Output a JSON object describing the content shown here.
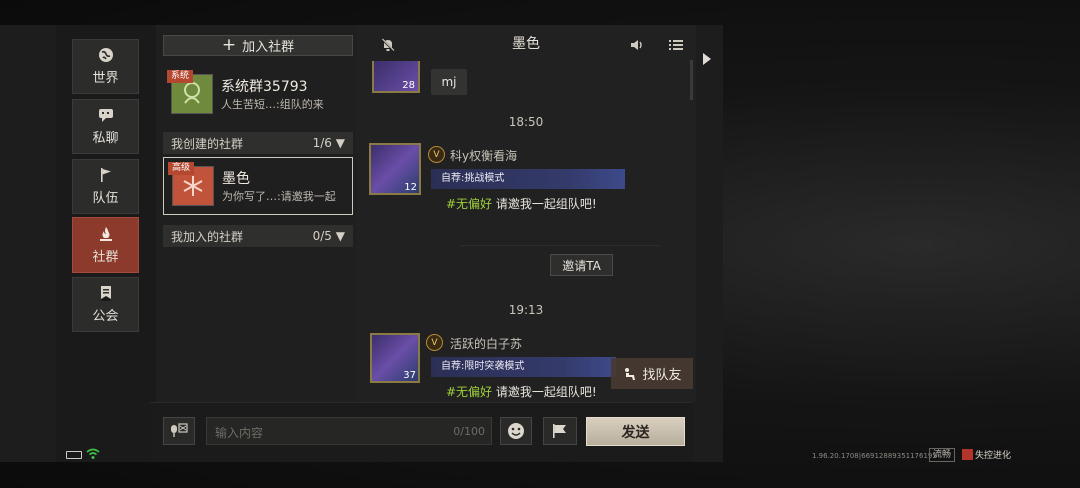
{
  "nav": {
    "items": [
      {
        "label": "世界",
        "icon": "globe-icon"
      },
      {
        "label": "私聊",
        "icon": "chat-icon"
      },
      {
        "label": "队伍",
        "icon": "flag-icon"
      },
      {
        "label": "社群",
        "icon": "campfire-icon",
        "active": true
      },
      {
        "label": "公会",
        "icon": "guild-banner-icon"
      }
    ]
  },
  "groups": {
    "join_label": "加入社群",
    "system": {
      "tag": "系统",
      "name": "系统群35793",
      "last_msg": "人生苦短…:组队的来"
    },
    "created_header": {
      "label": "我创建的社群",
      "count": "1/6"
    },
    "created": [
      {
        "tag": "高级",
        "name": "墨色",
        "last_msg": "为你写了…:请邀我一起"
      }
    ],
    "joined_header": {
      "label": "我加入的社群",
      "count": "0/5"
    }
  },
  "chat": {
    "title": "墨色",
    "top_message": {
      "level": "28",
      "text": "mj"
    },
    "messages": [
      {
        "time": "18:50",
        "sender": "科y权衡看海",
        "vip": "V",
        "level": "12",
        "mode": "自荐:挑战模式",
        "hashtag": "#无偏好",
        "text": "请邀我一起组队吧!"
      },
      {
        "time": "19:13",
        "sender": "活跃的白子苏",
        "vip": "V",
        "level": "37",
        "mode": "自荐:限时突袭模式",
        "hashtag": "#无偏好",
        "text": "请邀我一起组队吧!"
      }
    ],
    "invite_label": "邀请TA",
    "find_team_label": "找队友"
  },
  "input": {
    "placeholder": "输入内容",
    "counter": "0/100",
    "send_label": "发送"
  },
  "status": {
    "version": "1.96.20.1708|66912889351176195",
    "fluency": "流畅",
    "brand": "失控进化"
  },
  "colors": {
    "active_nav": "#8b3a2c",
    "hashtag": "#9fcf3c",
    "tag_red": "#b4472f"
  }
}
